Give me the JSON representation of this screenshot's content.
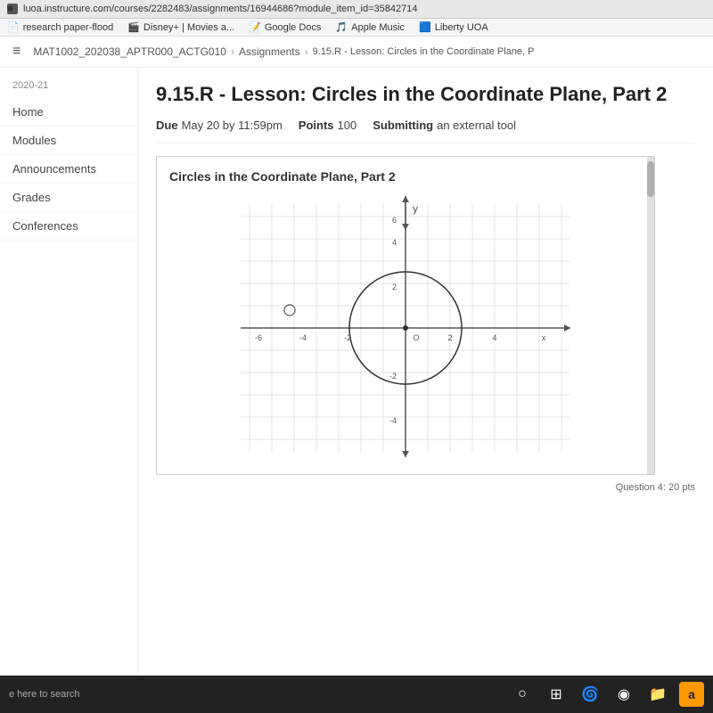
{
  "browser": {
    "url": "luoa.instructure.com/courses/2282483/assignments/16944686?module_item_id=35842714",
    "favicon_color": "#555"
  },
  "bookmarks": [
    {
      "label": "research paper-flood",
      "icon": "📄"
    },
    {
      "label": "Disney+ | Movies a...",
      "icon": "🎬"
    },
    {
      "label": "Google Docs",
      "icon": "📝"
    },
    {
      "label": "Apple Music",
      "icon": "🎵"
    },
    {
      "label": "Liberty UOA",
      "icon": "🟦"
    }
  ],
  "breadcrumb": {
    "course": "MAT1002_202038_APTR000_ACTG010",
    "section1": "Assignments",
    "section2": "9.15.R - Lesson: Circles in the Coordinate Plane, P"
  },
  "sidebar": {
    "year": "2020-21",
    "items": [
      {
        "label": "Home"
      },
      {
        "label": "Modules"
      },
      {
        "label": "Announcements"
      },
      {
        "label": "Grades"
      },
      {
        "label": "Conferences"
      }
    ]
  },
  "assignment": {
    "title": "9.15.R - Lesson: Circles in the Coordinate Plane, Part 2",
    "due_label": "Due",
    "due_value": "May 20 by 11:59pm",
    "points_label": "Points",
    "points_value": "100",
    "submitting_label": "Submitting",
    "submitting_value": "an external tool"
  },
  "card": {
    "title": "Circles in the Coordinate Plane, Part 2",
    "question_text": "Question 4: 20 pts"
  },
  "taskbar": {
    "search_text": "e here to search",
    "icons": [
      "○",
      "⊞",
      "🌀",
      "◉",
      "📁",
      "a"
    ]
  },
  "graph": {
    "x_min": -7,
    "x_max": 6,
    "y_min": -5,
    "y_max": 7,
    "circle_cx": 0,
    "circle_cy": 0,
    "circle_r": 2.5,
    "grid_step": 2
  }
}
